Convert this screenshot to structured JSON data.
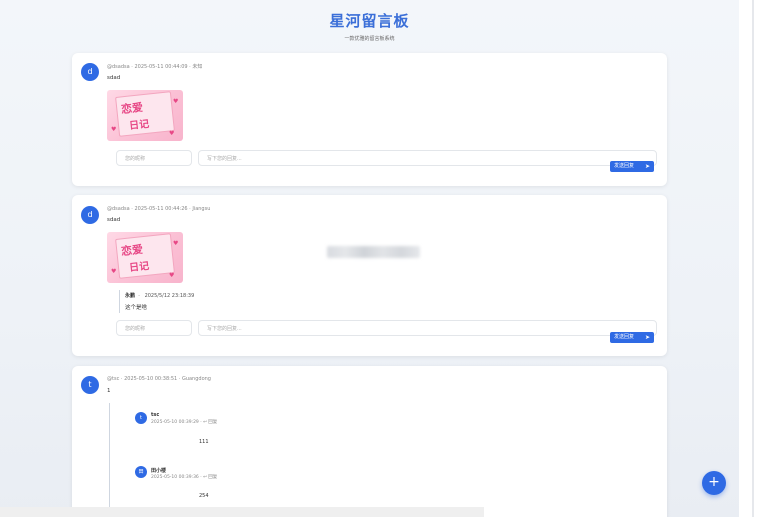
{
  "header": {
    "title": "星河留言板",
    "subtitle": "一款优雅的留言板系统"
  },
  "messages": [
    {
      "avatar_letter": "d",
      "meta": "@dsadsa · 2025-05-11 00:44:09 · 未知",
      "content": "sdad",
      "sticker": {
        "line1": "恋爱",
        "line2": "日记"
      },
      "nickname_placeholder": "您的昵称",
      "reply_placeholder": "写下您的回复...",
      "reply_button": "发送回复"
    },
    {
      "avatar_letter": "d",
      "meta": "@dsadsa · 2025-05-11 00:44:26 · Jiangsu",
      "content": "sdad",
      "sticker": {
        "line1": "恋爱",
        "line2": "日记"
      },
      "reply": {
        "author": "永鹏",
        "time": "2025/5/12 23:18:39",
        "text": "这个是啥"
      },
      "nickname_placeholder": "您的昵称",
      "reply_placeholder": "写下您的回复...",
      "reply_button": "发送回复"
    },
    {
      "avatar_letter": "t",
      "meta": "@tsc · 2025-05-10 00:38:51 · Guangdong",
      "content": "1",
      "replies": [
        {
          "avatar_letter": "t",
          "author": "tsc",
          "meta": "2025-05-10 00:39:29 · ↩ 回复",
          "text": "111"
        },
        {
          "avatar_letter": "田",
          "author": "田小楼",
          "meta": "2025-05-10 00:39:36 · ↩ 回复",
          "text": "254"
        }
      ]
    }
  ],
  "fab": {
    "label": "+"
  },
  "colors": {
    "accent": "#2f6ae4",
    "title": "#3b6fd8",
    "sticker_pink": "#f8b4cc"
  }
}
